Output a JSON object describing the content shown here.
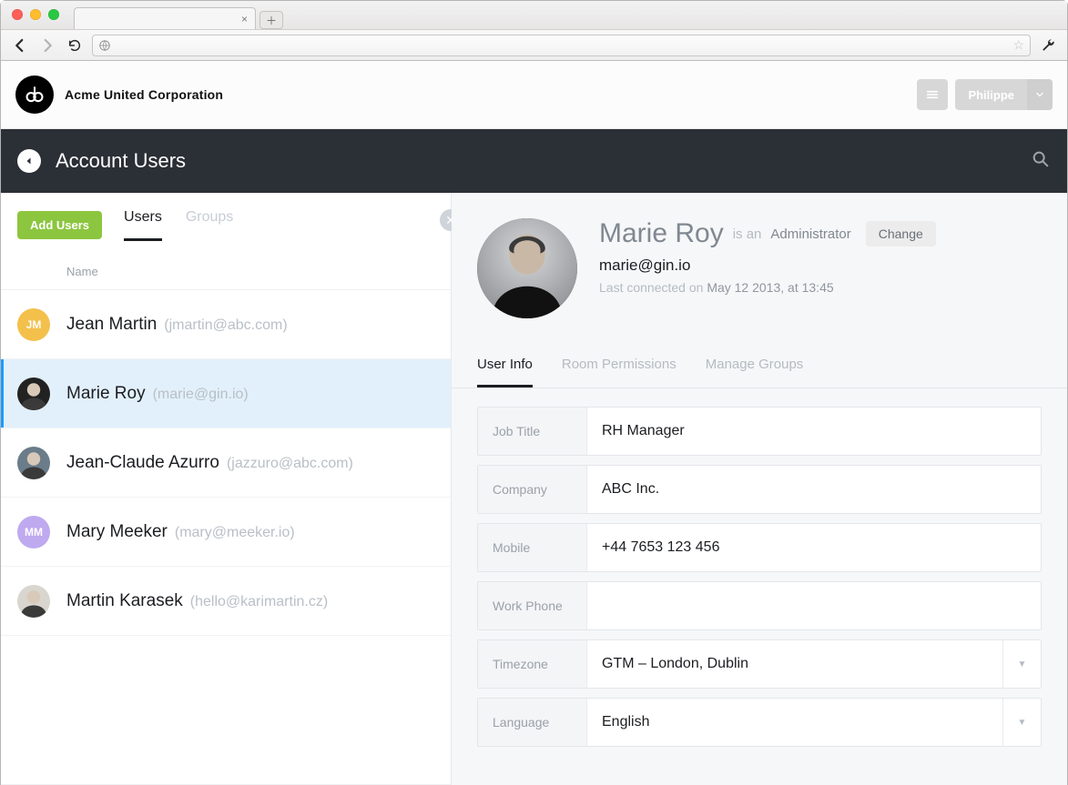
{
  "browser": {
    "url": ""
  },
  "app": {
    "company_name": "Acme United Corporation",
    "current_user": "Philippe"
  },
  "darkbar": {
    "title": "Account Users"
  },
  "left": {
    "add_users_label": "Add Users",
    "tabs": {
      "users": "Users",
      "groups": "Groups"
    },
    "column_header": "Name",
    "users": [
      {
        "initials": "JM",
        "name": "Jean Martin",
        "email": "(jmartin@abc.com)",
        "avatar_bg": "#f3c04b",
        "selected": false
      },
      {
        "initials": "",
        "name": "Marie Roy",
        "email": "(marie@gin.io)",
        "avatar_bg": "#222",
        "selected": true
      },
      {
        "initials": "",
        "name": "Jean-Claude Azurro",
        "email": "(jazzuro@abc.com)",
        "avatar_bg": "#6b7c8a",
        "selected": false
      },
      {
        "initials": "MM",
        "name": "Mary Meeker",
        "email": "(mary@meeker.io)",
        "avatar_bg": "#bfa9ef",
        "selected": false
      },
      {
        "initials": "",
        "name": "Martin Karasek",
        "email": "(hello@karimartin.cz)",
        "avatar_bg": "#d9d5cf",
        "selected": false
      }
    ]
  },
  "profile": {
    "name": "Marie Roy",
    "role_prefix": "is an",
    "role": "Administrator",
    "change_label": "Change",
    "email": "marie@gin.io",
    "last_prefix": "Last connected on",
    "last_value": "May 12 2013, at 13:45"
  },
  "detail_tabs": {
    "user_info": "User Info",
    "room_permissions": "Room Permissions",
    "manage_groups": "Manage Groups"
  },
  "form": {
    "job_title_label": "Job Title",
    "job_title_value": "RH Manager",
    "company_label": "Company",
    "company_value": "ABC Inc.",
    "mobile_label": "Mobile",
    "mobile_value": "+44 7653 123 456",
    "work_phone_label": "Work Phone",
    "work_phone_value": "",
    "timezone_label": "Timezone",
    "timezone_value": "GTM – London, Dublin",
    "language_label": "Language",
    "language_value": "English"
  }
}
